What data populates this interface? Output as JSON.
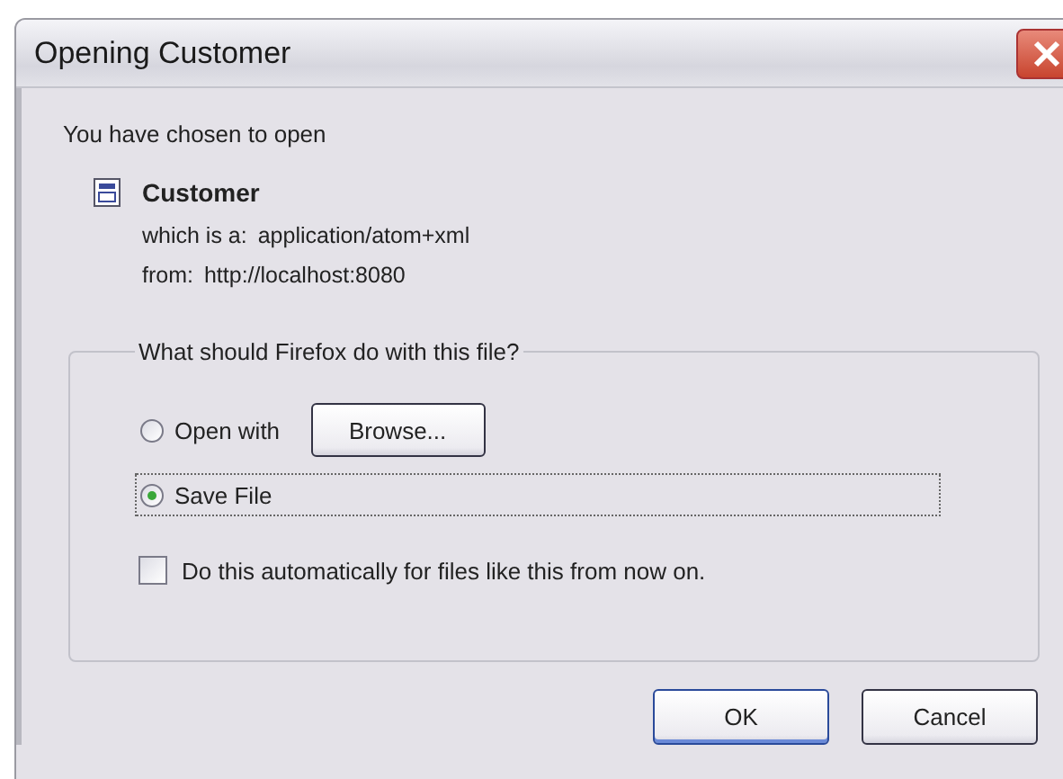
{
  "window": {
    "title": "Opening Customer"
  },
  "intro": "You have chosen to open",
  "file": {
    "name": "Customer",
    "type_label": "which is a:",
    "type_value": "application/atom+xml",
    "from_label": "from:",
    "from_value": "http://localhost:8080"
  },
  "group": {
    "legend": "What should Firefox do with this file?",
    "options": [
      {
        "label": "Open with",
        "selected": false,
        "focused": false
      },
      {
        "label": "Save File",
        "selected": true,
        "focused": true
      }
    ],
    "browse_button": "Browse...",
    "auto_checkbox": {
      "label": "Do this automatically for files like this from now on.",
      "checked": false
    }
  },
  "buttons": [
    {
      "label": "OK",
      "default": true
    },
    {
      "label": "Cancel",
      "default": false
    }
  ]
}
